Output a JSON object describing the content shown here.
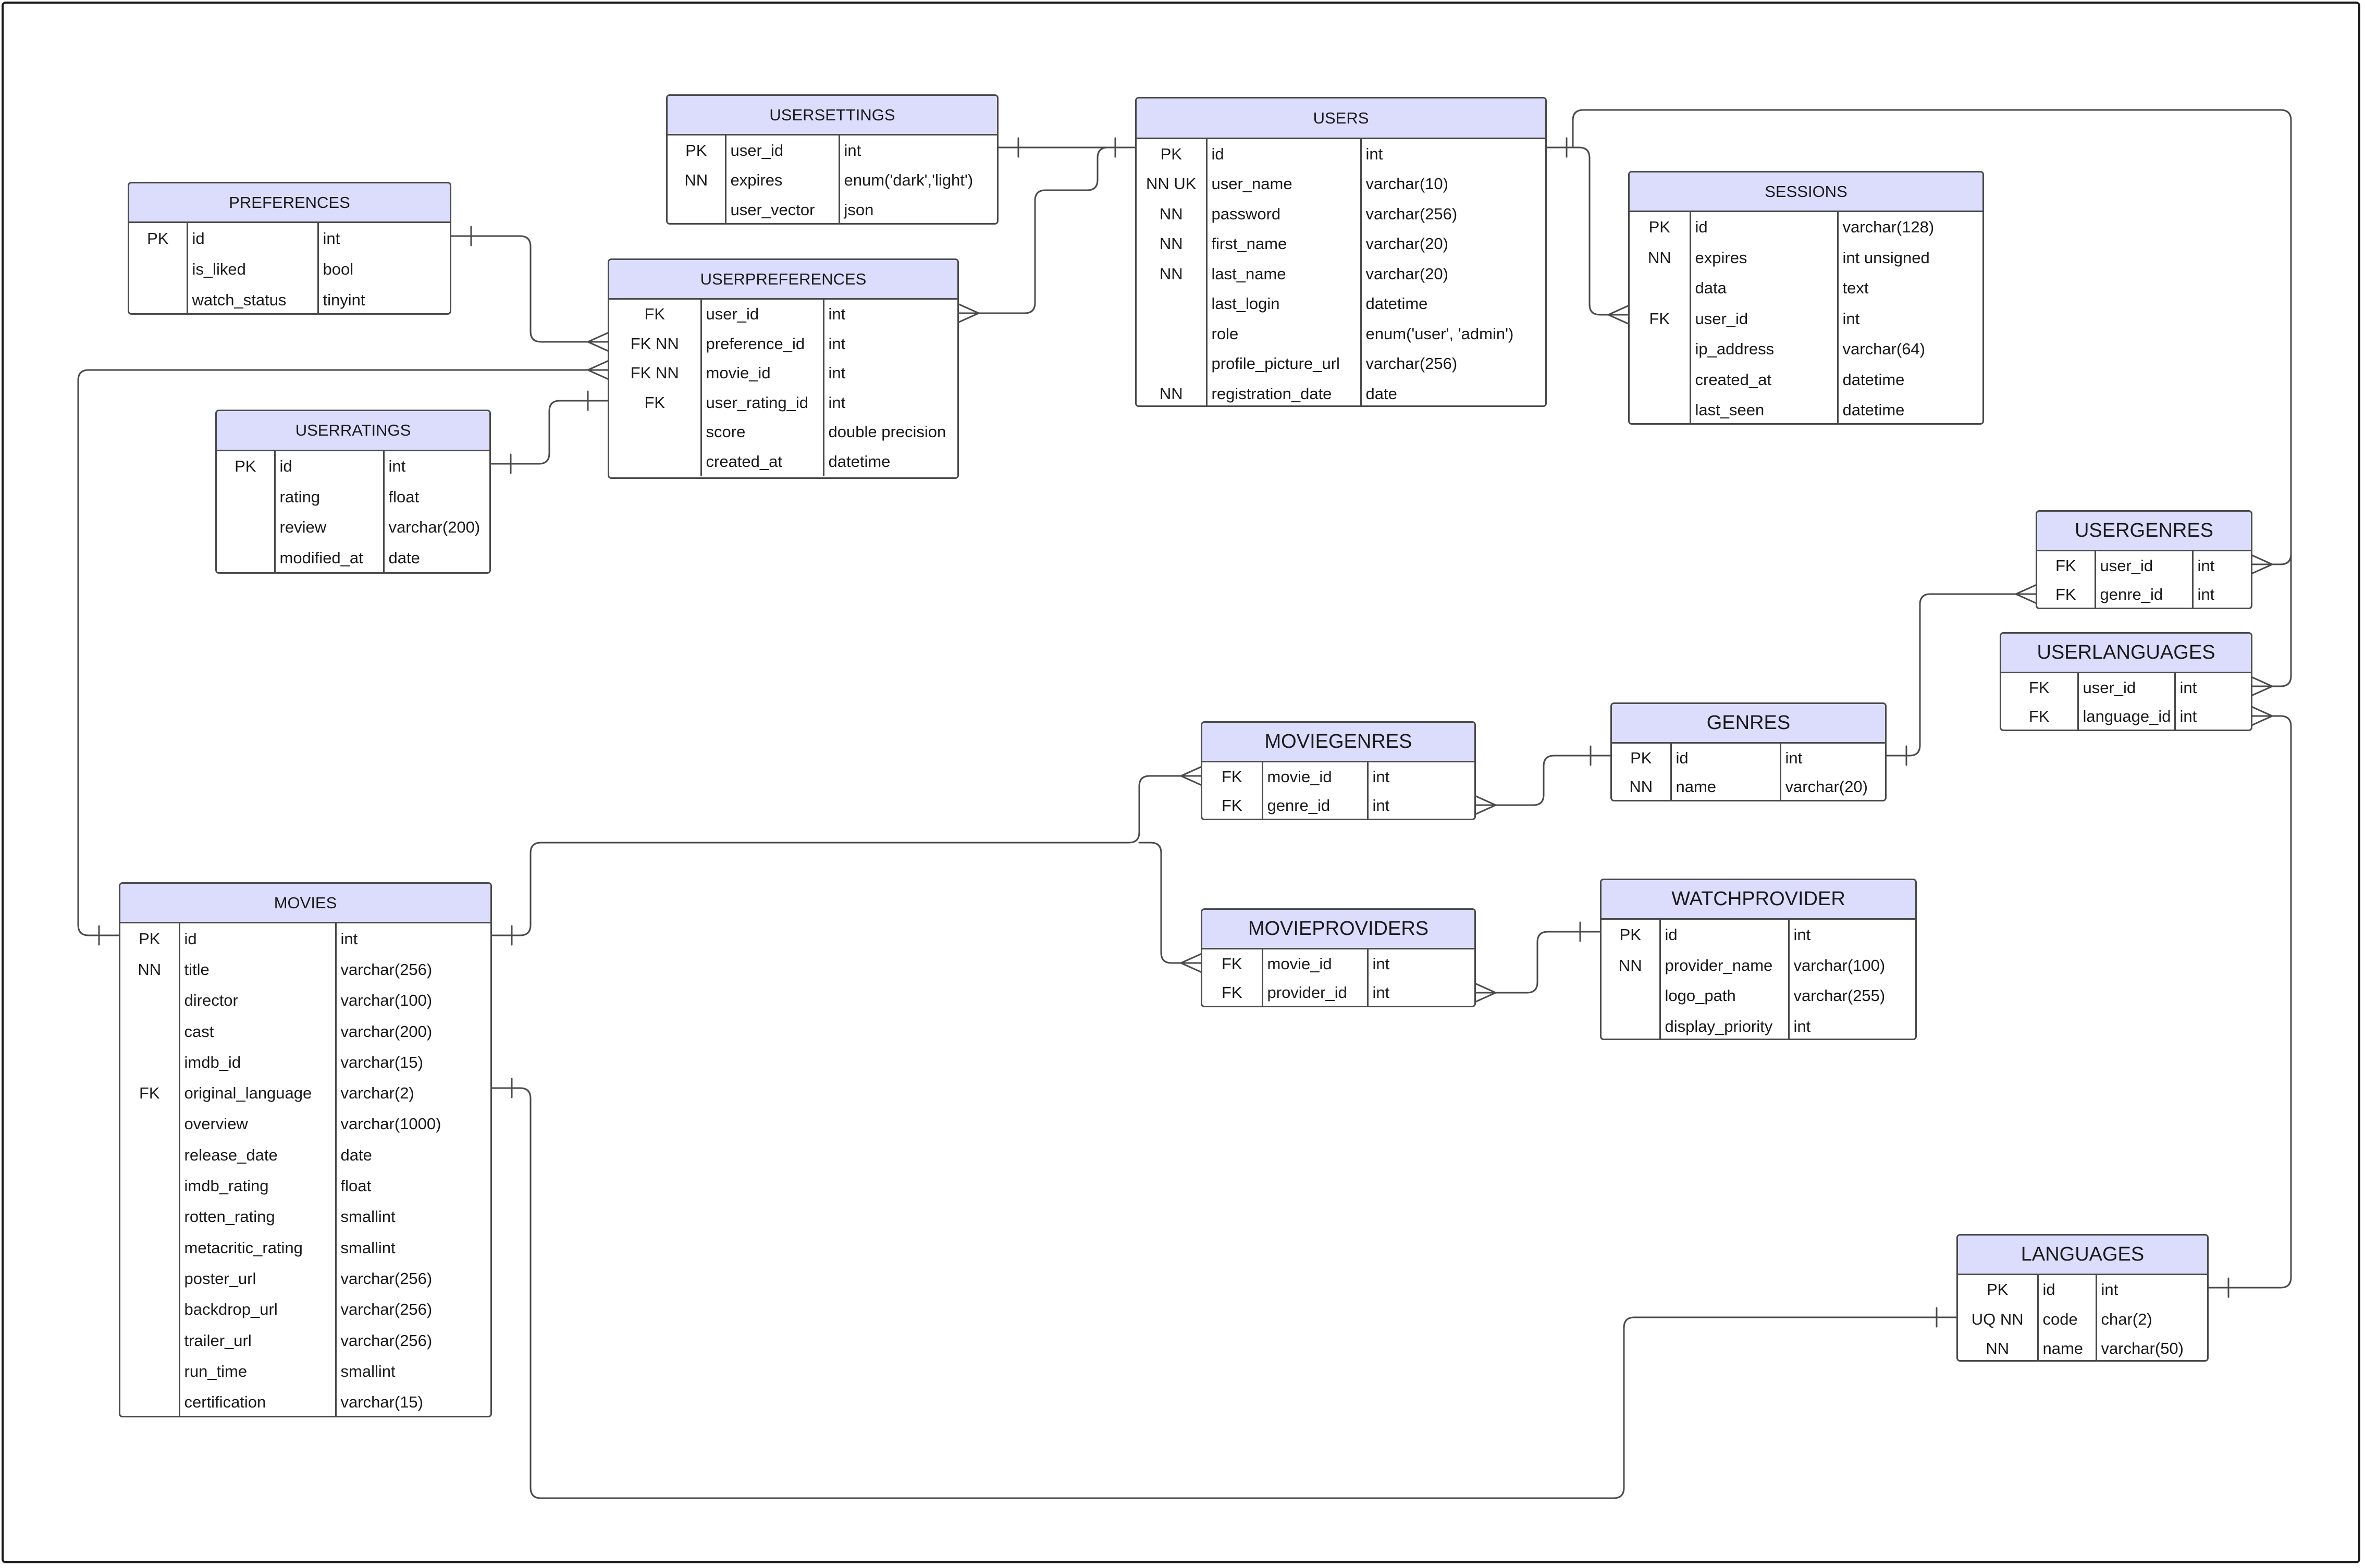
{
  "entities": [
    {
      "id": "USERSETTINGS",
      "title": "USERSETTINGS",
      "rows": [
        [
          "PK",
          "user_id",
          "int"
        ],
        [
          "NN",
          "expires",
          "enum('dark','light')"
        ],
        [
          "",
          "user_vector",
          "json"
        ]
      ]
    },
    {
      "id": "USERS",
      "title": "USERS",
      "rows": [
        [
          "PK",
          "id",
          "int"
        ],
        [
          "NN UK",
          "user_name",
          "varchar(10)"
        ],
        [
          "NN",
          "password",
          "varchar(256)"
        ],
        [
          "NN",
          "first_name",
          "varchar(20)"
        ],
        [
          "NN",
          "last_name",
          "varchar(20)"
        ],
        [
          "",
          "last_login",
          "datetime"
        ],
        [
          "",
          "role",
          "enum('user', 'admin')"
        ],
        [
          "",
          "profile_picture_url",
          "varchar(256)"
        ],
        [
          "NN",
          "registration_date",
          "date"
        ]
      ]
    },
    {
      "id": "PREFERENCES",
      "title": "PREFERENCES",
      "rows": [
        [
          "PK",
          "id",
          "int"
        ],
        [
          "",
          "is_liked",
          "bool"
        ],
        [
          "",
          "watch_status",
          "tinyint"
        ]
      ]
    },
    {
      "id": "USERPREFERENCES",
      "title": "USERPREFERENCES",
      "rows": [
        [
          "FK",
          "user_id",
          "int"
        ],
        [
          "FK NN",
          "preference_id",
          "int"
        ],
        [
          "FK NN",
          "movie_id",
          "int"
        ],
        [
          "FK",
          "user_rating_id",
          "int"
        ],
        [
          "",
          "score",
          "double precision"
        ],
        [
          "",
          "created_at",
          "datetime"
        ]
      ]
    },
    {
      "id": "SESSIONS",
      "title": "SESSIONS",
      "rows": [
        [
          "PK",
          "id",
          "varchar(128)"
        ],
        [
          "NN",
          "expires",
          "int unsigned"
        ],
        [
          "",
          "data",
          "text"
        ],
        [
          "FK",
          "user_id",
          "int"
        ],
        [
          "",
          "ip_address",
          "varchar(64)"
        ],
        [
          "",
          "created_at",
          "datetime"
        ],
        [
          "",
          "last_seen",
          "datetime"
        ]
      ]
    },
    {
      "id": "USERRATINGS",
      "title": "USERRATINGS",
      "rows": [
        [
          "PK",
          "id",
          "int"
        ],
        [
          "",
          "rating",
          "float"
        ],
        [
          "",
          "review",
          "varchar(200)"
        ],
        [
          "",
          "modified_at",
          "date"
        ]
      ]
    },
    {
      "id": "USERGENRES",
      "title": "USERGENRES",
      "rows": [
        [
          "FK",
          "user_id",
          "int"
        ],
        [
          "FK",
          "genre_id",
          "int"
        ]
      ]
    },
    {
      "id": "USERLANGUAGES",
      "title": "USERLANGUAGES",
      "rows": [
        [
          "FK",
          "user_id",
          "int"
        ],
        [
          "FK",
          "language_id",
          "int"
        ]
      ]
    },
    {
      "id": "GENRES",
      "title": "GENRES",
      "rows": [
        [
          "PK",
          "id",
          "int"
        ],
        [
          "NN",
          "name",
          "varchar(20)"
        ]
      ]
    },
    {
      "id": "MOVIEGENRES",
      "title": "MOVIEGENRES",
      "rows": [
        [
          "FK",
          "movie_id",
          "int"
        ],
        [
          "FK",
          "genre_id",
          "int"
        ]
      ]
    },
    {
      "id": "MOVIES",
      "title": "MOVIES",
      "rows": [
        [
          "PK",
          "id",
          "int"
        ],
        [
          "NN",
          "title",
          "varchar(256)"
        ],
        [
          "",
          "director",
          "varchar(100)"
        ],
        [
          "",
          "cast",
          "varchar(200)"
        ],
        [
          "",
          "imdb_id",
          "varchar(15)"
        ],
        [
          "FK",
          "original_language",
          "varchar(2)"
        ],
        [
          "",
          "overview",
          "varchar(1000)"
        ],
        [
          "",
          "release_date",
          "date"
        ],
        [
          "",
          "imdb_rating",
          "float"
        ],
        [
          "",
          "rotten_rating",
          "smallint"
        ],
        [
          "",
          "metacritic_rating",
          "smallint"
        ],
        [
          "",
          "poster_url",
          "varchar(256)"
        ],
        [
          "",
          "backdrop_url",
          "varchar(256)"
        ],
        [
          "",
          "trailer_url",
          "varchar(256)"
        ],
        [
          "",
          "run_time",
          "smallint"
        ],
        [
          "",
          "certification",
          "varchar(15)"
        ]
      ]
    },
    {
      "id": "MOVIEPROVIDERS",
      "title": "MOVIEPROVIDERS",
      "rows": [
        [
          "FK",
          "movie_id",
          "int"
        ],
        [
          "FK",
          "provider_id",
          "int"
        ]
      ]
    },
    {
      "id": "WATCHPROVIDER",
      "title": "WATCHPROVIDER",
      "rows": [
        [
          "PK",
          "id",
          "int"
        ],
        [
          "NN",
          "provider_name",
          "varchar(100)"
        ],
        [
          "",
          "logo_path",
          "varchar(255)"
        ],
        [
          "",
          "display_priority",
          "int"
        ]
      ]
    },
    {
      "id": "LANGUAGES",
      "title": "LANGUAGES",
      "rows": [
        [
          "PK",
          "id",
          "int"
        ],
        [
          "UQ NN",
          "code",
          "char(2)"
        ],
        [
          "NN",
          "name",
          "varchar(50)"
        ]
      ]
    }
  ],
  "relationships": [
    {
      "from": "USERSETTINGS.user_id",
      "from_card": "one",
      "to": "USERS.id",
      "to_card": "one"
    },
    {
      "from": "USERPREFERENCES.user_id",
      "from_card": "many",
      "to": "USERS.id",
      "to_card": "one"
    },
    {
      "from": "PREFERENCES.id",
      "from_card": "one",
      "to": "USERPREFERENCES.preference_id",
      "to_card": "many"
    },
    {
      "from": "USERRATINGS.id",
      "from_card": "one",
      "to": "USERPREFERENCES.user_rating_id",
      "to_card": "one"
    },
    {
      "from": "MOVIES.id",
      "from_card": "one",
      "to": "USERPREFERENCES.movie_id",
      "to_card": "many"
    },
    {
      "from": "USERS.id",
      "from_card": "one",
      "to": "SESSIONS.user_id",
      "to_card": "many"
    },
    {
      "from": "USERS.id",
      "from_card": "one",
      "to": "USERGENRES.user_id",
      "to_card": "many"
    },
    {
      "from": "USERS.id",
      "from_card": "one",
      "to": "USERLANGUAGES.user_id",
      "to_card": "many"
    },
    {
      "from": "GENRES.id",
      "from_card": "one",
      "to": "USERGENRES.genre_id",
      "to_card": "many"
    },
    {
      "from": "GENRES.id",
      "from_card": "one",
      "to": "MOVIEGENRES.genre_id",
      "to_card": "many"
    },
    {
      "from": "MOVIES.id",
      "from_card": "one",
      "to": "MOVIEGENRES.movie_id",
      "to_card": "many"
    },
    {
      "from": "MOVIES.id",
      "from_card": "one",
      "to": "MOVIEPROVIDERS.movie_id",
      "to_card": "many"
    },
    {
      "from": "WATCHPROVIDER.id",
      "from_card": "one",
      "to": "MOVIEPROVIDERS.provider_id",
      "to_card": "many"
    },
    {
      "from": "LANGUAGES.id",
      "from_card": "one",
      "to": "USERLANGUAGES.language_id",
      "to_card": "many"
    },
    {
      "from": "MOVIES.original_language",
      "from_card": "one",
      "to": "LANGUAGES.code",
      "to_card": "one"
    }
  ]
}
